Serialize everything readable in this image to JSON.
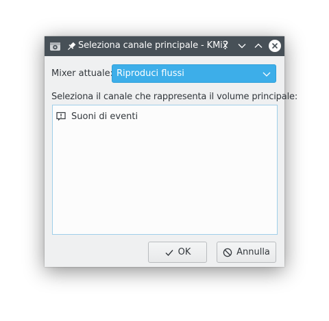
{
  "window": {
    "title": "Seleziona canale principale - KMix",
    "help_glyph": "?"
  },
  "form": {
    "mixer_label": "Mixer attuale:",
    "mixer_value": "Riproduci flussi",
    "select_label": "Seleziona il canale che rappresenta il volume principale:"
  },
  "channels": [
    {
      "label": "Suoni di eventi",
      "icon": "event-sounds-icon"
    }
  ],
  "buttons": {
    "ok_label": "OK",
    "cancel_label": "Annulla"
  },
  "colors": {
    "titlebar": "#475057",
    "accent": "#3daee9",
    "window_bg": "#eff0f1"
  }
}
